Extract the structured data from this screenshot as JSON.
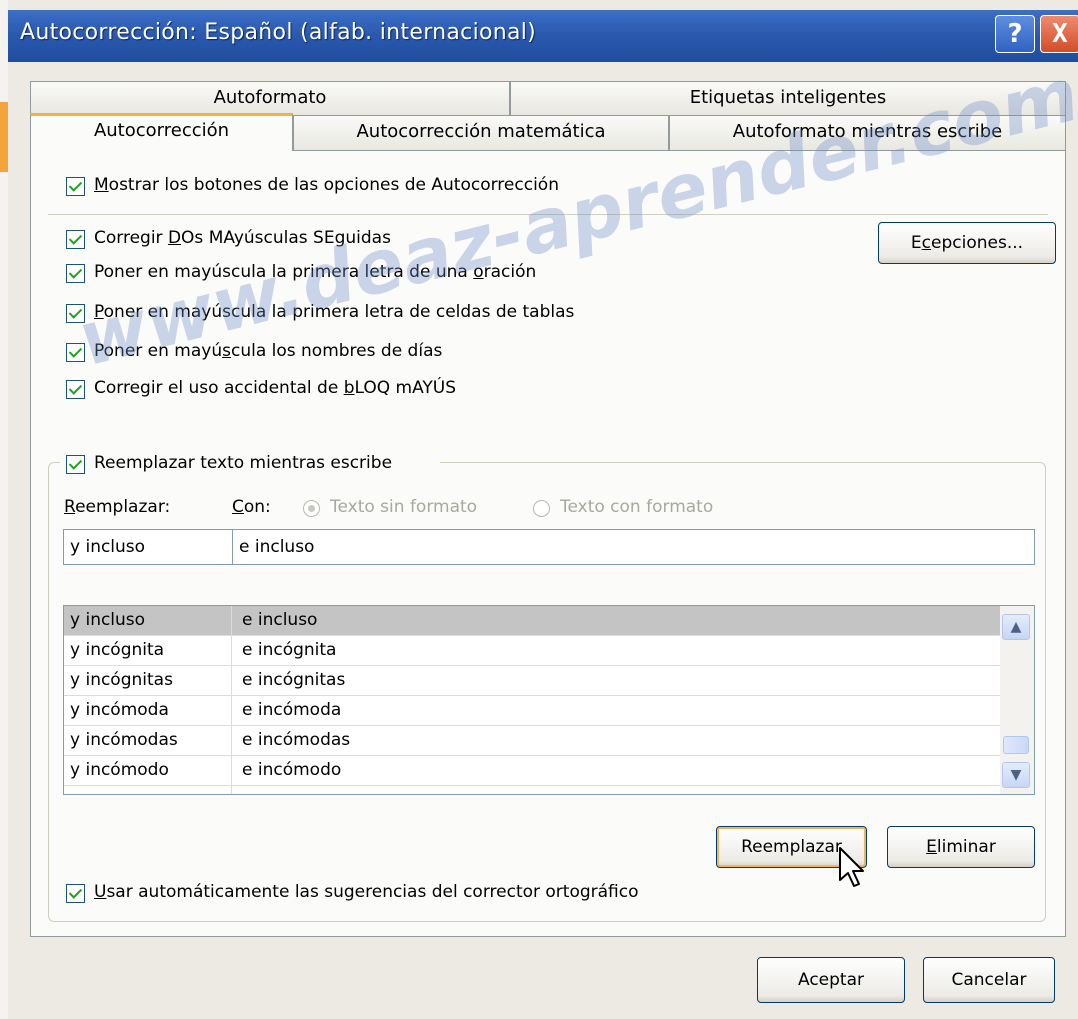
{
  "window": {
    "title": "Autocorrección: Español (alfab. internacional)",
    "help_label": "?",
    "close_label": "X"
  },
  "tabs_row1": [
    {
      "label": "Autoformato"
    },
    {
      "label": "Etiquetas inteligentes"
    }
  ],
  "tabs_row2": [
    {
      "label": "Autocorrección",
      "active": true
    },
    {
      "label": "Autocorrección matemática"
    },
    {
      "label": "Autoformato mientras escribe"
    }
  ],
  "options": {
    "show_buttons": {
      "pre": "",
      "u": "M",
      "post": "ostrar los botones de las opciones de Autocorrección",
      "checked": true
    },
    "two_caps": {
      "pre": "Corregir ",
      "u": "D",
      "post": "Os MAyúsculas SEguidas",
      "checked": true
    },
    "sentence": {
      "pre": "Poner en mayúscula la primera letra de una ",
      "u": "o",
      "post": "ración",
      "checked": true
    },
    "cells": {
      "pre": "",
      "u": "P",
      "post": "oner en mayúscula la primera letra de celdas de tablas",
      "checked": true
    },
    "days": {
      "pre": "Poner en mayú",
      "u": "s",
      "post": "cula los nombres de días",
      "checked": true
    },
    "caps_lock": {
      "pre": "Corregir el uso accidental de ",
      "u": "b",
      "post": "LOQ mAYÚS",
      "checked": true
    },
    "exceptions_label": "Excepciones...",
    "exceptions_u": "c"
  },
  "replace": {
    "group_label": "Reemplazar texto mientras escribe",
    "checked": true,
    "replace_label_u": "R",
    "replace_label_rest": "eemplazar:",
    "with_label_u": "C",
    "with_label_rest": "on:",
    "radio_plain": "Texto sin formato",
    "radio_formatted": "Texto con formato",
    "replace_value": "y incluso",
    "with_value": "e incluso"
  },
  "table": {
    "rows": [
      {
        "from": "y incluso",
        "to": "e incluso",
        "selected": true
      },
      {
        "from": "y incógnita",
        "to": "e incógnita"
      },
      {
        "from": "y incógnitas",
        "to": "e incógnitas"
      },
      {
        "from": "y incómoda",
        "to": "e incómoda"
      },
      {
        "from": "y incómodas",
        "to": "e incómodas"
      },
      {
        "from": "y incómodo",
        "to": "e incómodo"
      }
    ]
  },
  "buttons": {
    "replace": "Reemplazar",
    "delete_u": "E",
    "delete_rest": "liminar",
    "ok": "Aceptar",
    "cancel": "Cancelar"
  },
  "spelling": {
    "pre": "",
    "u": "U",
    "post": "sar automáticamente las sugerencias del corrector ortográfico",
    "checked": true
  },
  "watermark": "www.deaz-aprender.com",
  "colors": {
    "title_bar": "#2a58ad",
    "tab_accent": "#f6b142",
    "check": "#21a121",
    "close": "#d34d2a"
  }
}
